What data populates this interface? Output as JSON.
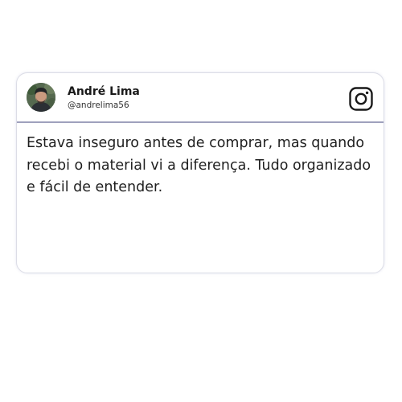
{
  "post": {
    "author_name": "André Lima",
    "author_handle": "@andrelima56",
    "text": "Estava inseguro antes de comprar, mas quando recebi o material vi a diferença. Tudo organizado e fácil de entender.",
    "platform_icon": "instagram-icon",
    "avatar_icon": "user-avatar-photo"
  },
  "colors": {
    "divider": "#9fa1bd",
    "card_border": "#dcdde6",
    "text": "#1f1f1f"
  }
}
